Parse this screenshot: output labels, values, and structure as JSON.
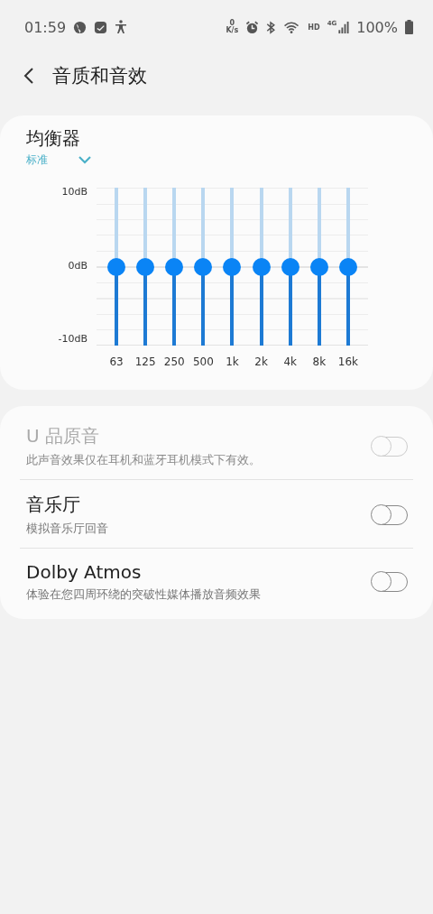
{
  "status_bar": {
    "time": "01:59",
    "speed_value": "0",
    "speed_unit": "K/s",
    "hd": "HD",
    "network": "4G",
    "battery": "100%"
  },
  "header": {
    "title": "音质和音效"
  },
  "equalizer": {
    "title": "均衡器",
    "preset": "标准",
    "y_labels": [
      "10dB",
      "0dB",
      "-10dB"
    ],
    "bands": [
      {
        "label": "63",
        "level": 0.5
      },
      {
        "label": "125",
        "level": 0.5
      },
      {
        "label": "250",
        "level": 0.5
      },
      {
        "label": "500",
        "level": 0.5
      },
      {
        "label": "1k",
        "level": 0.5
      },
      {
        "label": "2k",
        "level": 0.5
      },
      {
        "label": "4k",
        "level": 0.5
      },
      {
        "label": "8k",
        "level": 0.5
      },
      {
        "label": "16k",
        "level": 0.5
      }
    ]
  },
  "settings": [
    {
      "title": "U 品原音",
      "subtitle": "此声音效果仅在耳机和蓝牙耳机模式下有效。",
      "on": false,
      "disabled": true
    },
    {
      "title": "音乐厅",
      "subtitle": "模拟音乐厅回音",
      "on": false,
      "disabled": false
    },
    {
      "title": "Dolby Atmos",
      "subtitle": "体验在您四周环绕的突破性媒体播放音频效果",
      "on": false,
      "disabled": false
    }
  ]
}
